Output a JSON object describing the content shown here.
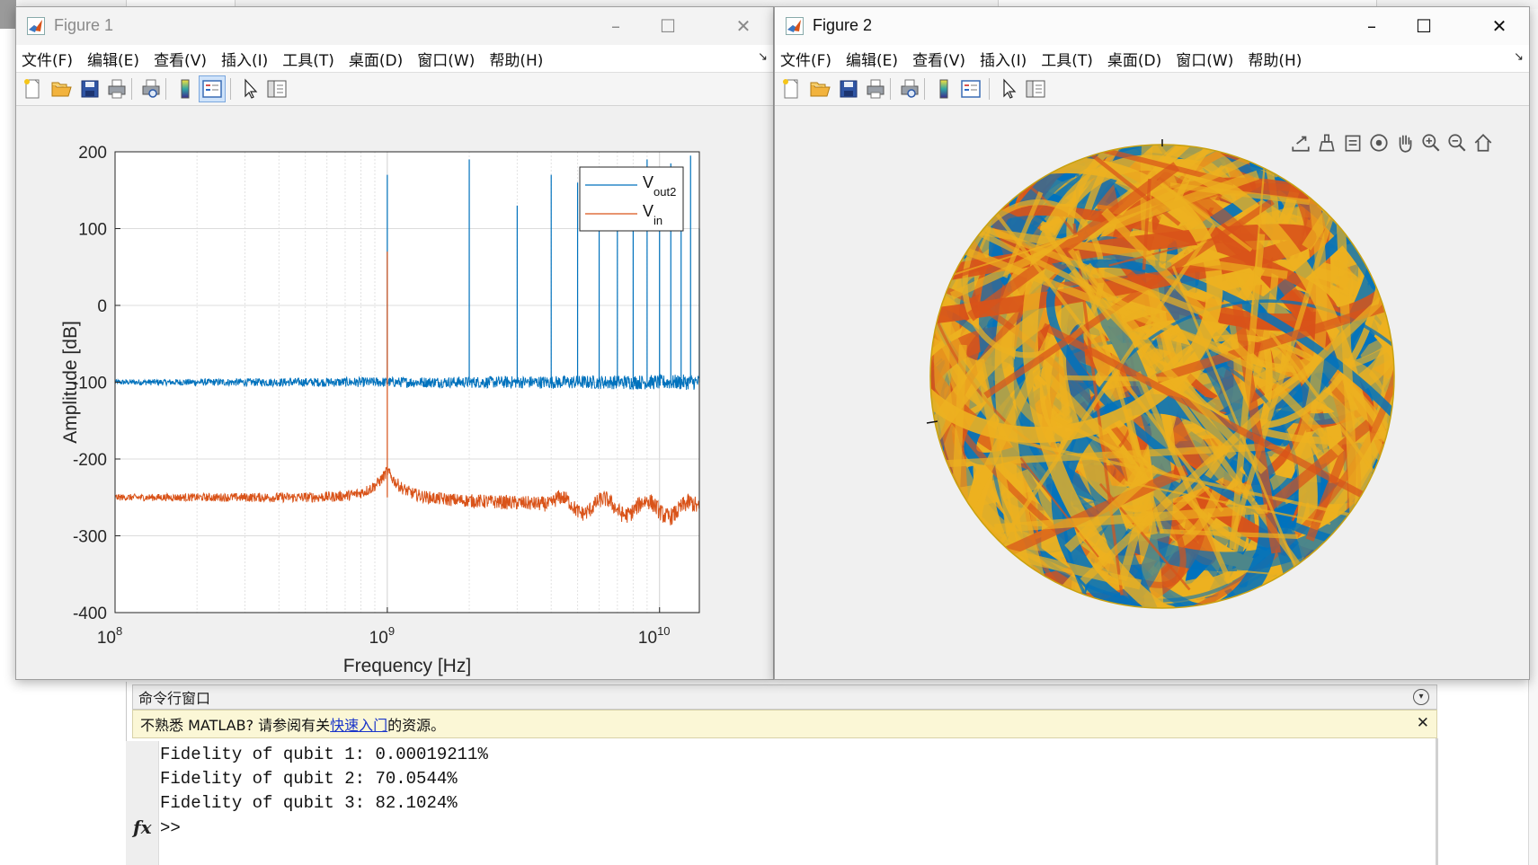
{
  "figure1": {
    "title": "Figure 1",
    "menu": [
      "文件(F)",
      "编辑(E)",
      "查看(V)",
      "插入(I)",
      "工具(T)",
      "桌面(D)",
      "窗口(W)",
      "帮助(H)"
    ],
    "toolbar_icons": [
      "new-figure-icon",
      "open-file-icon",
      "save-icon",
      "print-icon",
      "print-preview-icon",
      "insert-colorbar-icon",
      "insert-legend-icon",
      "edit-plot-arrow-icon",
      "show-plot-tools-icon"
    ],
    "chart_data": {
      "type": "line",
      "xlabel": "Frequency [Hz]",
      "ylabel": "Amplitude [dB]",
      "xscale": "log",
      "xlim": [
        100000000.0,
        14000000000.0
      ],
      "ylim": [
        -400,
        200
      ],
      "yticks": [
        "200",
        "100",
        "0",
        "-100",
        "-200",
        "-300",
        "-400"
      ],
      "xticks": [
        {
          "base": "10",
          "exp": "8"
        },
        {
          "base": "10",
          "exp": "9"
        },
        {
          "base": "10",
          "exp": "10"
        }
      ],
      "grid": true,
      "legend_position": "top-right",
      "series": [
        {
          "name": "V",
          "sub": "out2",
          "color": "#0072BD",
          "baseline_db": -100,
          "noise_db": 12,
          "peaks": [
            [
              1000000000.0,
              170
            ],
            [
              2000000000.0,
              190
            ],
            [
              3000000000.0,
              130
            ],
            [
              4000000000.0,
              170
            ],
            [
              5000000000.0,
              160
            ],
            [
              6000000000.0,
              125
            ],
            [
              7000000000.0,
              160
            ],
            [
              8000000000.0,
              130
            ],
            [
              9000000000.0,
              190
            ],
            [
              10000000000.0,
              155
            ],
            [
              11000000000.0,
              185
            ],
            [
              12000000000.0,
              140
            ],
            [
              13000000000.0,
              195
            ],
            [
              14000000000.0,
              100
            ]
          ]
        },
        {
          "name": "V",
          "sub": "in",
          "color": "#D95319",
          "baseline_db": -250,
          "noise_db": 14,
          "peaks": [
            [
              1000000000.0,
              70
            ]
          ]
        }
      ]
    }
  },
  "figure2": {
    "title": "Figure 2",
    "menu": [
      "文件(F)",
      "编辑(E)",
      "查看(V)",
      "插入(I)",
      "工具(T)",
      "桌面(D)",
      "窗口(W)",
      "帮助(H)"
    ],
    "toolbar_icons": [
      "new-figure-icon",
      "open-file-icon",
      "save-icon",
      "print-icon",
      "print-preview-icon",
      "insert-colorbar-icon",
      "insert-legend-icon",
      "edit-plot-arrow-icon",
      "show-plot-tools-icon"
    ],
    "axes_toolbar_icons": [
      "export-icon",
      "brush-icon",
      "data-tips-icon",
      "rotate-3d-icon",
      "pan-hand-icon",
      "zoom-in-icon",
      "zoom-out-icon",
      "home-icon"
    ],
    "sphere_colors": [
      "#0072BD",
      "#EDB120",
      "#D95319"
    ]
  },
  "command_window": {
    "title": "命令行窗口",
    "banner_prefix": "不熟悉 MATLAB? 请参阅有关",
    "banner_link": "快速入门",
    "banner_suffix": "的资源。",
    "output_lines": [
      "Fidelity of qubit 1: 0.00019211%",
      "Fidelity of qubit 2: 70.0544%",
      "Fidelity of qubit 3: 82.1024%"
    ],
    "fx": "fx",
    "prompt": ">>"
  }
}
